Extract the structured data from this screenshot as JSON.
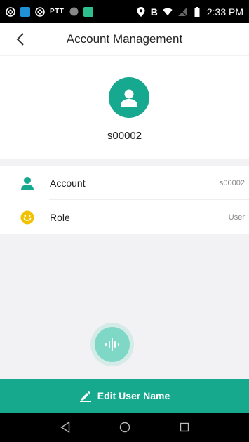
{
  "status_bar": {
    "ptt": "PTT",
    "time": "2:33 PM",
    "carrier_letter": "B"
  },
  "header": {
    "title": "Account Management"
  },
  "profile": {
    "username": "s00002"
  },
  "rows": [
    {
      "label": "Account",
      "value": "s00002",
      "icon": "person-icon",
      "icon_color": "#16a98f"
    },
    {
      "label": "Role",
      "value": "User",
      "icon": "smiley-icon",
      "icon_color": "#f2c200"
    }
  ],
  "edit_button": {
    "label": "Edit User Name"
  },
  "colors": {
    "accent": "#17a98e",
    "voice": "#7fd8c5",
    "background": "#f2f2f4"
  }
}
